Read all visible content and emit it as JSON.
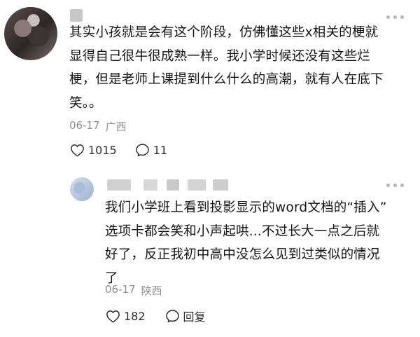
{
  "main_comment": {
    "text": "其实小孩就是会有这个阶段，仿佛懂这些x相关的梗就\n显得自己很牛很成熟一样。我小学时候还没有这些烂\n梗，但是老师上课提到什么什么的高潮，就有人在底下\n笑。。",
    "date": "06-17",
    "location": "广西",
    "like_count": "1015",
    "reply_count": "11",
    "like_icon": "heart-outline-icon",
    "reply_icon": "comment-bubble-icon"
  },
  "reply_comment": {
    "text": "我们小学班上看到投影显示的word文档的“插入”\n选项卡都会笑和小声起哄...不过长大一点之后就\n好了，反正我初中高中没怎么见到过类似的情况\n了",
    "date": "06-17",
    "location": "陕西",
    "like_count": "182",
    "reply_label": "回复",
    "like_icon": "heart-outline-icon",
    "reply_icon": "comment-bubble-icon"
  },
  "colors": {
    "text": "#141414",
    "meta": "#8e8e8e",
    "icon": "#2b2b2b",
    "dots": "#b5b5b5"
  }
}
